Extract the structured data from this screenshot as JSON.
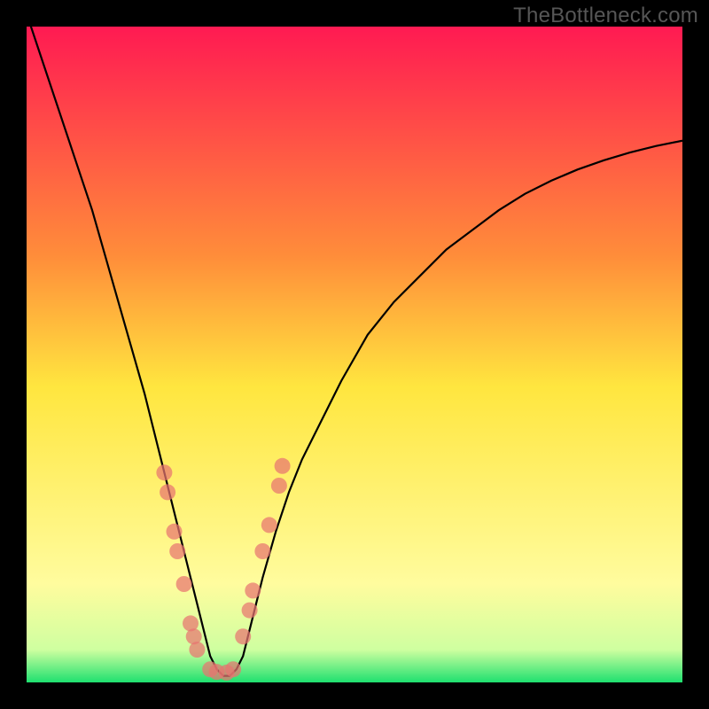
{
  "watermark": "TheBottleneck.com",
  "chart_data": {
    "type": "line",
    "title": "",
    "xlabel": "",
    "ylabel": "",
    "xlim": [
      0,
      100
    ],
    "ylim": [
      0,
      100
    ],
    "grid": false,
    "background_gradient": {
      "stops": [
        {
          "offset": 0,
          "color": "#ff1a52"
        },
        {
          "offset": 35,
          "color": "#ff8d3a"
        },
        {
          "offset": 55,
          "color": "#ffe63f"
        },
        {
          "offset": 85,
          "color": "#fffc9e"
        },
        {
          "offset": 95,
          "color": "#cfffa0"
        },
        {
          "offset": 100,
          "color": "#1fe06f"
        }
      ]
    },
    "series": [
      {
        "name": "bottleneck-curve",
        "type": "line",
        "x": [
          0,
          2,
          4,
          6,
          8,
          10,
          12,
          14,
          16,
          18,
          20,
          21,
          22,
          23,
          24,
          25,
          26,
          27,
          28,
          29,
          30,
          31,
          32,
          33,
          34,
          35,
          36,
          38,
          40,
          42,
          45,
          48,
          52,
          56,
          60,
          64,
          68,
          72,
          76,
          80,
          84,
          88,
          92,
          96,
          100
        ],
        "y": [
          102,
          96,
          90,
          84,
          78,
          72,
          65,
          58,
          51,
          44,
          36,
          32,
          28,
          24,
          20,
          16,
          12,
          8,
          4,
          2,
          1,
          1,
          2,
          4,
          8,
          12,
          16,
          23,
          29,
          34,
          40,
          46,
          53,
          58,
          62,
          66,
          69,
          72,
          74.5,
          76.5,
          78.2,
          79.6,
          80.8,
          81.8,
          82.6
        ]
      },
      {
        "name": "markers-left-run",
        "type": "scatter",
        "x": [
          21,
          21.5,
          22.5,
          23.0,
          24.0,
          25.0,
          25.5,
          26.0
        ],
        "y": [
          32,
          29,
          23,
          20,
          15,
          9,
          7,
          5
        ]
      },
      {
        "name": "markers-trough",
        "type": "scatter",
        "x": [
          28.0,
          29.0,
          30.5,
          31.5
        ],
        "y": [
          2.0,
          1.6,
          1.5,
          2.0
        ]
      },
      {
        "name": "markers-right-run",
        "type": "scatter",
        "x": [
          33.0,
          34.0,
          34.5,
          36.0,
          37.0,
          38.5,
          39.0
        ],
        "y": [
          7,
          11,
          14,
          20,
          24,
          30,
          33
        ]
      }
    ]
  }
}
